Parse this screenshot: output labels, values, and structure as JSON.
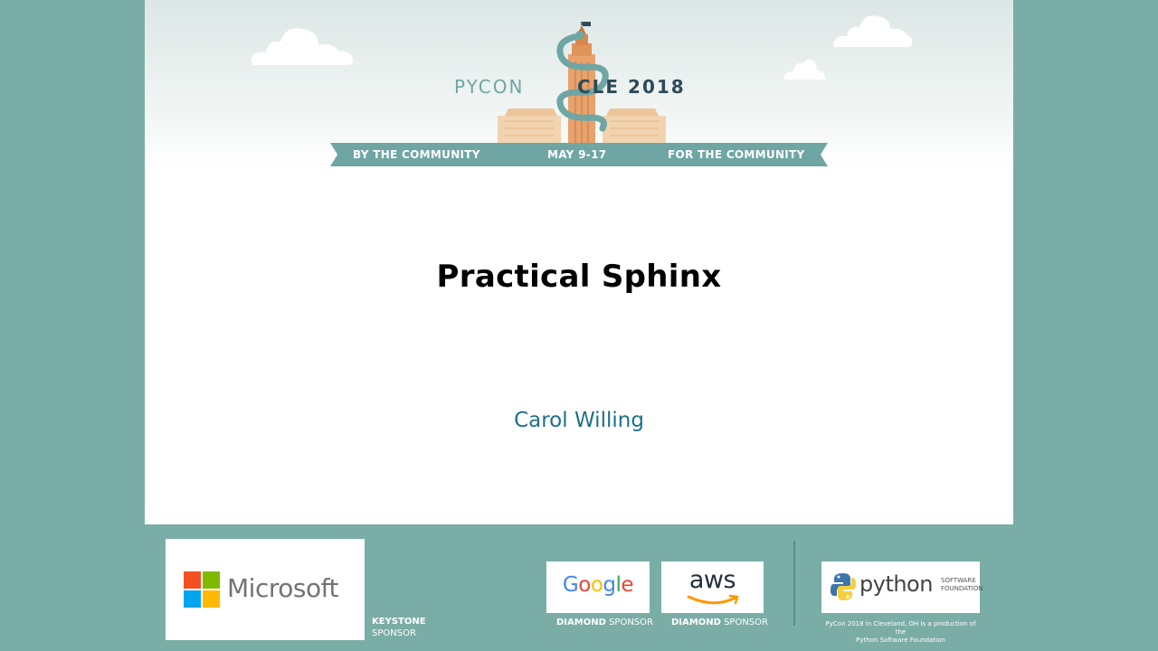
{
  "header": {
    "brand_left": "PYCON",
    "brand_right": "CLE 2018",
    "ribbon": {
      "left": "BY THE COMMUNITY",
      "center": "MAY 9-17",
      "right": "FOR THE COMMUNITY"
    }
  },
  "slide": {
    "title": "Practical Sphinx",
    "speaker": "Carol Willing"
  },
  "sponsors": {
    "microsoft": {
      "wordmark": "Microsoft",
      "tier_line1": "KEYSTONE",
      "tier_line2": "SPONSOR"
    },
    "google": {
      "wordmark": "Google",
      "tier_bold": "DIAMOND",
      "tier_rest": " SPONSOR"
    },
    "aws": {
      "wordmark": "aws",
      "tier_bold": "DIAMOND",
      "tier_rest": " SPONSOR"
    },
    "psf": {
      "wordmark": "python",
      "software": "SOFTWARE",
      "foundation": "FOUNDATION",
      "note_line1": "PyCon 2018 in Cleveland, OH is a production of the",
      "note_line2": "Python Software Foundation"
    }
  },
  "colors": {
    "background_teal": "#7aada6",
    "ribbon_teal": "#6fa6a3",
    "speaker_blue": "#1f6f8b",
    "tower_orange": "#e8a36c"
  },
  "icons": [
    "cloud-icon",
    "terminal-tower-icon",
    "snake-icon",
    "microsoft-logo-icon",
    "aws-smile-icon",
    "python-logo-icon"
  ]
}
